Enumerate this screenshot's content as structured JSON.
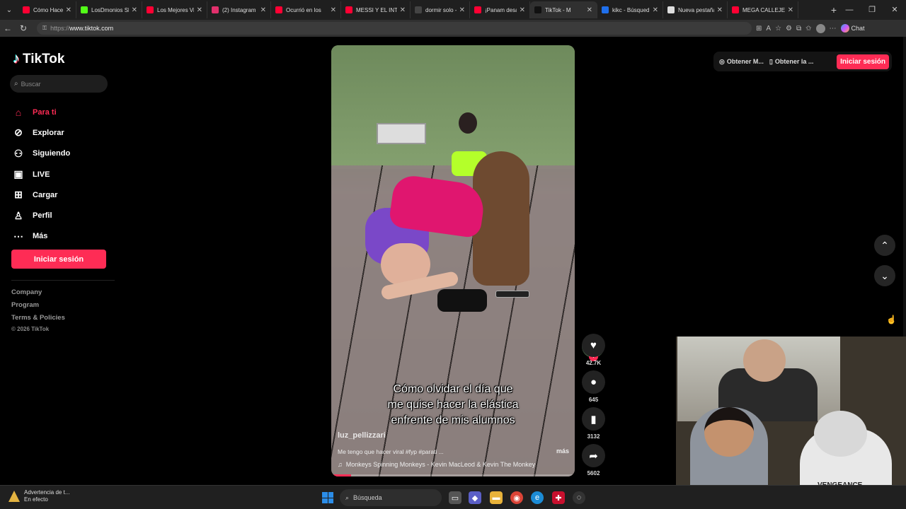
{
  "browser": {
    "tabs": [
      {
        "label": "Cómo Hacer Sl",
        "color": "#ff0033"
      },
      {
        "label": "LosDmonios Sh",
        "color": "#53fc18"
      },
      {
        "label": "Los Mejores Vi",
        "color": "#ff0033"
      },
      {
        "label": "(2) Instagram",
        "color": "#e1306c"
      },
      {
        "label": "Ocurrió en los",
        "color": "#ff0033"
      },
      {
        "label": "MESSI Y EL INT",
        "color": "#ff0033"
      },
      {
        "label": "dormir solo - B",
        "color": "#444444"
      },
      {
        "label": "¡Panam desat",
        "color": "#ff0033"
      },
      {
        "label": "TikTok - M",
        "color": "#111111"
      },
      {
        "label": "kikc - Búsqued",
        "color": "#1f6feb"
      },
      {
        "label": "Nueva pestaña",
        "color": "#dddddd"
      },
      {
        "label": "MEGA CALLEJE",
        "color": "#ff0033"
      }
    ],
    "url_protocol": "https://",
    "url_host": "www.tiktok.com",
    "chat_label": "Chat"
  },
  "sidebar": {
    "brand": "TikTok",
    "search_placeholder": "Buscar",
    "items": [
      {
        "label": "Para ti",
        "icon": "home-icon"
      },
      {
        "label": "Explorar",
        "icon": "compass-icon"
      },
      {
        "label": "Siguiendo",
        "icon": "following-icon"
      },
      {
        "label": "LIVE",
        "icon": "live-icon"
      },
      {
        "label": "Cargar",
        "icon": "upload-icon"
      },
      {
        "label": "Perfil",
        "icon": "profile-icon"
      },
      {
        "label": "Más",
        "icon": "more-icon"
      }
    ],
    "login_label": "Iniciar sesión",
    "footer": {
      "company": "Company",
      "program": "Program",
      "terms": "Terms & Policies",
      "copyright": "© 2026 TikTok"
    }
  },
  "video": {
    "caption_lines": [
      "Cómo olvidar el día que",
      "me quise hacer la elástica",
      "enfrente de mis alumnos"
    ],
    "author": "luz_pellizzari",
    "description": "Me tengo que hacer viral #fyp #parati ...",
    "more_label": "más",
    "music": "Monkeys Spinning Monkeys - Kevin MacLeod & Kevin The Monkey",
    "progress": 0.08
  },
  "actions": {
    "likes": "42.7K",
    "comments": "645",
    "saves": "3132",
    "shares": "5602"
  },
  "topbar": {
    "get_app_1": "Obtener M...",
    "get_app_2": "Obtener la ...",
    "signin_label": "Iniciar sesión"
  },
  "taskbar": {
    "warning_title": "Advertencia de t...",
    "warning_status": "En efecto",
    "search_label": "Búsqueda"
  },
  "colors": {
    "accent": "#fe2c55",
    "background": "#000000"
  },
  "cam": {
    "shirt_text": "VENGEANCE"
  }
}
